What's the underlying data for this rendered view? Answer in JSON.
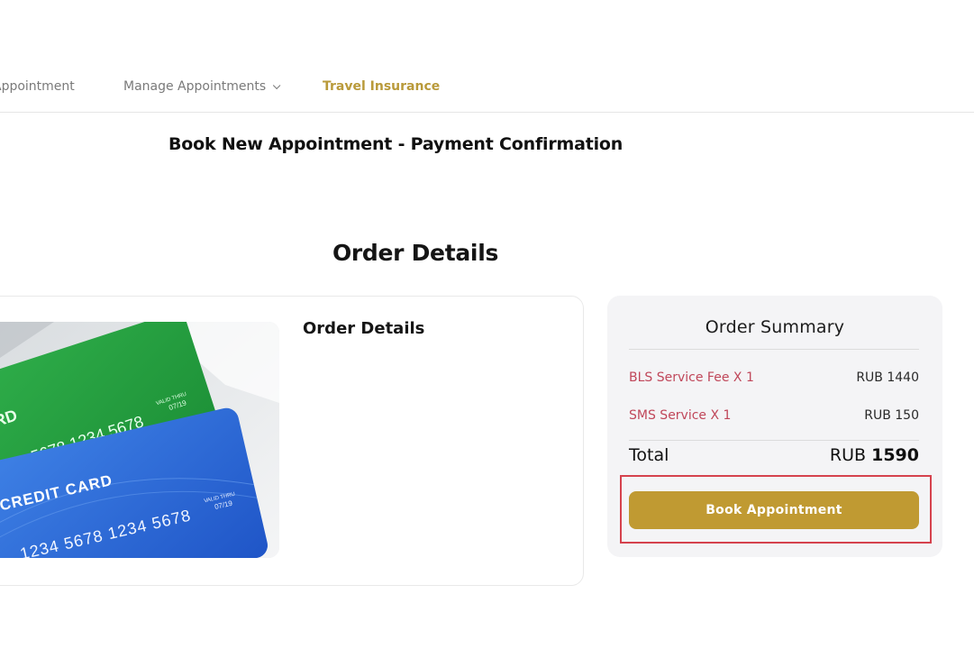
{
  "nav": {
    "items": [
      {
        "label": "Appointment"
      },
      {
        "label": "Manage Appointments"
      },
      {
        "label": "Travel Insurance"
      }
    ],
    "accent_color": "#b99a3a"
  },
  "page_title": "Book New Appointment - Payment Confirmation",
  "section_title": "Order Details",
  "details_card": {
    "heading": "Order Details",
    "image": {
      "green_card": {
        "label": "ARD",
        "number": "5678 1234 5678",
        "valid_label": "VALID THRU",
        "expiry": "07/19"
      },
      "blue_card": {
        "label": "CREDIT CARD",
        "number": "1234 5678 1234 5678",
        "valid_label": "VALID THRU",
        "expiry": "07/19"
      }
    }
  },
  "order_summary": {
    "title": "Order Summary",
    "lines": [
      {
        "label": "BLS Service Fee X 1",
        "amount": "RUB 1440"
      },
      {
        "label": "SMS Service X 1",
        "amount": "RUB 150"
      }
    ],
    "total_label": "Total",
    "total_currency": "RUB",
    "total_value": "1590",
    "button_label": "Book Appointment",
    "button_color": "#c09a32",
    "highlight_color": "#d5424d"
  }
}
